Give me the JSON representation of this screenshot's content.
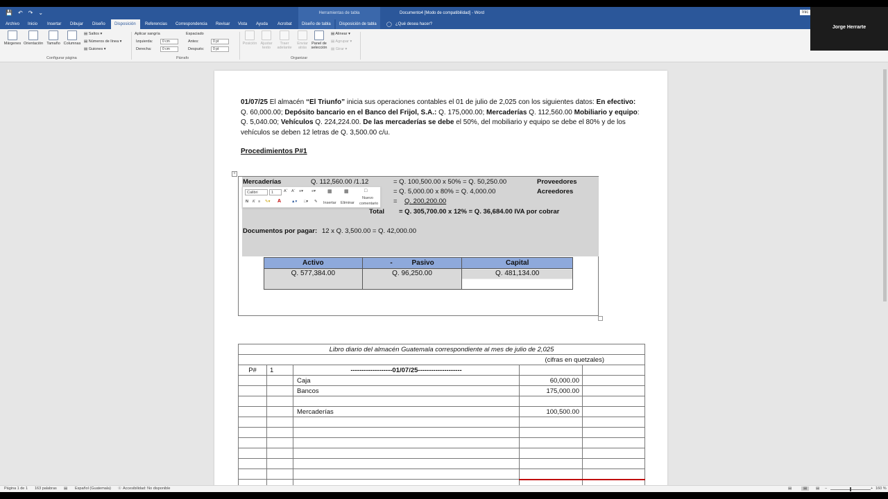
{
  "titlebar": {
    "context_title": "Herramientas de tabla",
    "doc_title": "Documento4 [Modo de compatibilidad] - Word",
    "signin": "Inic"
  },
  "account": {
    "name": "Jorge Herrarte"
  },
  "tabs": [
    "Archivo",
    "Inicio",
    "Insertar",
    "Dibujar",
    "Diseño",
    "Disposición",
    "Referencias",
    "Correspondencia",
    "Revisar",
    "Vista",
    "Ayuda",
    "Acrobat",
    "Diseño de tabla",
    "Disposición de tabla"
  ],
  "tellme": "¿Qué desea hacer?",
  "ribbon": {
    "margins": "Márgenes",
    "orientation": "Orientación",
    "size": "Tamaño",
    "columns": "Columnas",
    "breaks": "Saltos",
    "line_numbers": "Números de línea",
    "hyphenation": "Guiones",
    "group_page": "Configurar página",
    "indent_title": "Aplicar sangría",
    "indent_left": "Izquierda:",
    "indent_left_val": "0 cm",
    "indent_right": "Derecha:",
    "indent_right_val": "0 cm",
    "spacing_title": "Espaciado",
    "spacing_before": "Antes:",
    "spacing_before_val": "0 pt",
    "spacing_after": "Después:",
    "spacing_after_val": "0 pt",
    "group_paragraph": "Párrafo",
    "position": "Posición",
    "wrap_text_1": "Ajustar",
    "wrap_text_2": "texto",
    "bring_forward_1": "Traer",
    "bring_forward_2": "adelante",
    "send_back_1": "Enviar",
    "send_back_2": "atrás",
    "selection_pane_1": "Panel de",
    "selection_pane_2": "selección",
    "align": "Alinear",
    "group_obj": "Agrupar",
    "rotate": "Girar",
    "group_arrange": "Organizar"
  },
  "doc": {
    "p_date": "01/07/25",
    "p_1": " El almacén ",
    "p_name": "“El Triunfo”",
    "p_2": " inicia sus operaciones contables el 01 de julio de 2,025 con los siguientes datos: ",
    "p_b1": "En efectivo:",
    "p_3": " Q. 60,000.00; ",
    "p_b2": "Depósito bancario en el Banco del Frijol, S.A.:",
    "p_4": " Q. 175,000.00; ",
    "p_b3": "Mercaderías",
    "p_5": " Q. 112,560.00 ",
    "p_b4": "Mobiliario y equipo",
    "p_6": ": Q. 5,040.00; ",
    "p_b5": "Vehículos",
    "p_7": " Q. 224,224.00. ",
    "p_b6": "De las mercaderías se debe",
    "p_8": " el 50%, del mobiliario y equipo se debe el 80% y de los vehículos se deben 12 letras de Q. 3,500.00 c/u.",
    "procedimientos": "Procedimientos P#1"
  },
  "textbox": {
    "l1_label": "Mercaderías",
    "l1_calc": "Q. 112,560.00 /1.12",
    "l1_eq": "=  Q.  100,500.00    x 50%   =   Q. 50,250.00",
    "l1_acct": "Proveedores",
    "l2_eq": "=  Q.       5,000.00    x 80%   =   Q.    4,000.00",
    "l2_acct": "Acreedores",
    "l3_eq": "=",
    "l3_val": "Q. 200,200.00",
    "total_label": "Total",
    "total_eq": "=    Q. 305,700.00  x 12% = Q. 36,684.00 IVA por cobrar",
    "docs_label": "Documentos por pagar:",
    "docs_calc": " 12 x Q. 3,500.00 = Q. 42,000.00",
    "mini_font": "Calibri",
    "mini_size": "1",
    "mini_insert": "Insertar",
    "mini_delete": "Eliminar",
    "mini_comment_1": "Nuevo",
    "mini_comment_2": "comentario",
    "mini_bold": "N",
    "mini_italic": "K"
  },
  "capital": {
    "h_activo": "Activo",
    "h_minus": "-",
    "h_pasivo": "Pasivo",
    "h_capital": "Capital",
    "activo": "Q. 577,384.00",
    "pasivo": "Q. 96,250.00",
    "capital": "Q. 481,134.00"
  },
  "diario": {
    "title": "Libro diario del almacén Guatemala correspondiente al mes de julio de 2,025",
    "subtitle": "(cifras en quetzales)",
    "p_label": "P#",
    "p_num": "1",
    "date_line": "-------------------01/07/25--------------------",
    "rows": [
      {
        "account": "Caja",
        "debit": "60,000.00"
      },
      {
        "account": "Bancos",
        "debit": "175,000.00"
      },
      {
        "account": "",
        "debit": ""
      },
      {
        "account": "Mercaderías",
        "debit": "100,500.00"
      }
    ]
  },
  "status": {
    "page": "Página 1 de 1",
    "words": "163 palabras",
    "lang": "Español (Guatemala)",
    "access": "Accesibilidad: No disponible",
    "zoom": "160 %"
  }
}
